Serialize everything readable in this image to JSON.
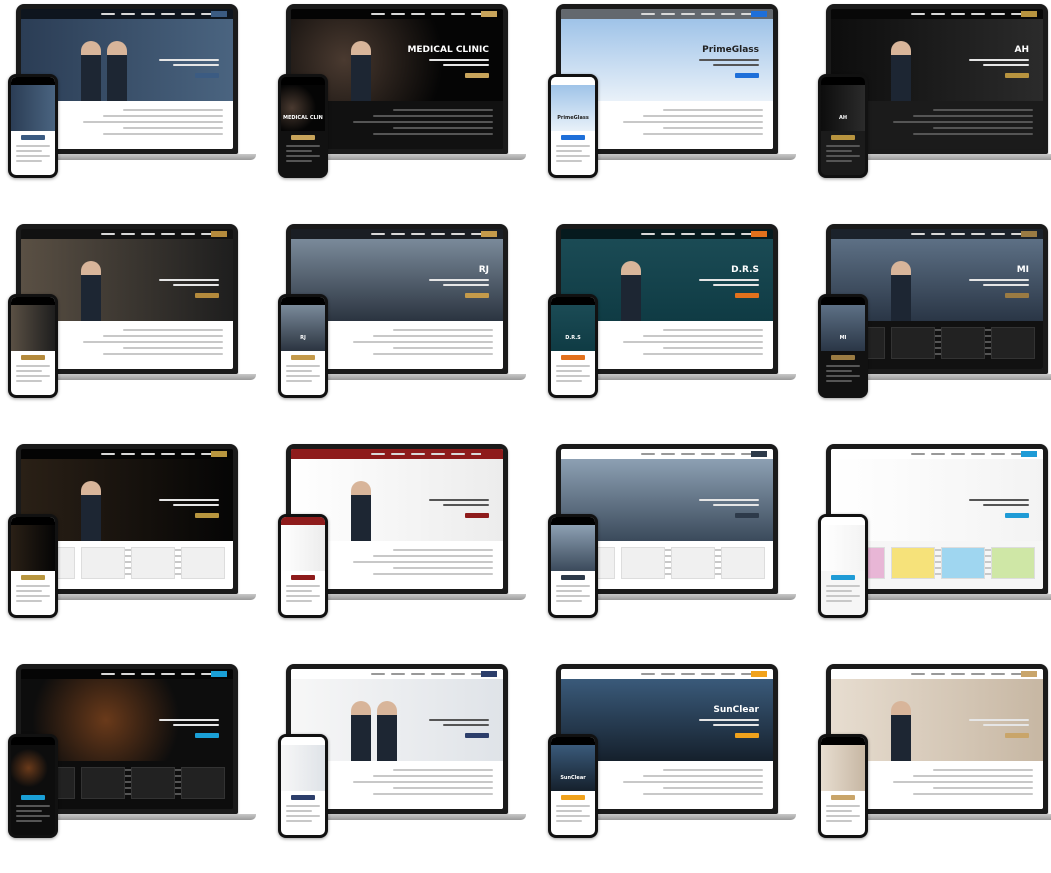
{
  "page": {
    "background": "#ffffff"
  },
  "tiles": [
    {
      "id": 1,
      "theme": "corporate-navy",
      "hero_title": "",
      "screen_bg": "#1f2f44",
      "accent": "#3b5b82",
      "body_bg": "#ffffff",
      "has_people": true
    },
    {
      "id": 2,
      "theme": "dark-clinic",
      "hero_title": "MEDICAL CLINIC",
      "screen_bg": "#0a0a0a",
      "accent": "#c8a45b",
      "body_bg": "#111111",
      "has_people": true
    },
    {
      "id": 3,
      "theme": "glass-blue",
      "hero_title": "PrimeGlass",
      "screen_bg": "#dbe7f4",
      "accent": "#1e6fd9",
      "body_bg": "#ffffff",
      "has_people": false
    },
    {
      "id": 4,
      "theme": "black-gold",
      "hero_title": "AH",
      "screen_bg": "#121212",
      "accent": "#b8943f",
      "body_bg": "#1b1b1b",
      "has_people": true
    },
    {
      "id": 5,
      "theme": "dark-gold-lawyer",
      "hero_title": "",
      "screen_bg": "#262626",
      "accent": "#b48a3c",
      "body_bg": "#ffffff",
      "has_people": true
    },
    {
      "id": 6,
      "theme": "finance-chart",
      "hero_title": "RJ",
      "screen_bg": "#3a4350",
      "accent": "#c49a4a",
      "body_bg": "#ffffff",
      "has_people": false
    },
    {
      "id": 7,
      "theme": "port-teal",
      "hero_title": "D.R.S",
      "screen_bg": "#0f3b44",
      "accent": "#e2711c",
      "body_bg": "#ffffff",
      "has_people": true
    },
    {
      "id": 8,
      "theme": "city-glass",
      "hero_title": "MI",
      "screen_bg": "#3d4d60",
      "accent": "#9a7b43",
      "body_bg": "#111111",
      "has_people": true
    },
    {
      "id": 9,
      "theme": "black-lawyer",
      "hero_title": "",
      "screen_bg": "#0b0b0b",
      "accent": "#b8963f",
      "body_bg": "#ffffff",
      "has_people": true
    },
    {
      "id": 10,
      "theme": "red-lawyer",
      "hero_title": "",
      "screen_bg": "#f2f2f2",
      "accent": "#8e1b1b",
      "body_bg": "#ffffff",
      "has_people": true
    },
    {
      "id": 11,
      "theme": "skyscraper",
      "hero_title": "",
      "screen_bg": "#5d6f83",
      "accent": "#2d3a4a",
      "body_bg": "#ffffff",
      "has_people": false
    },
    {
      "id": 12,
      "theme": "print-colors",
      "hero_title": "",
      "screen_bg": "#ffffff",
      "accent": "#1f9bd6",
      "body_bg": "#f6f6f6",
      "has_people": false
    },
    {
      "id": 13,
      "theme": "tech-dark",
      "hero_title": "",
      "screen_bg": "#0d0d0d",
      "accent": "#1a9fd6",
      "body_bg": "#0d0d0d",
      "has_people": false
    },
    {
      "id": 14,
      "theme": "white-partners",
      "hero_title": "",
      "screen_bg": "#eef0f2",
      "accent": "#2c3e6b",
      "body_bg": "#ffffff",
      "has_people": true
    },
    {
      "id": 15,
      "theme": "solar",
      "hero_title": "SunClear",
      "screen_bg": "#243447",
      "accent": "#f0a21c",
      "body_bg": "#ffffff",
      "has_people": false
    },
    {
      "id": 16,
      "theme": "beauty-white",
      "hero_title": "",
      "screen_bg": "#f3efe9",
      "accent": "#c9a56a",
      "body_bg": "#ffffff",
      "has_people": true
    }
  ],
  "icons": {
    "device-laptop": "laptop-icon",
    "device-phone": "phone-icon"
  }
}
